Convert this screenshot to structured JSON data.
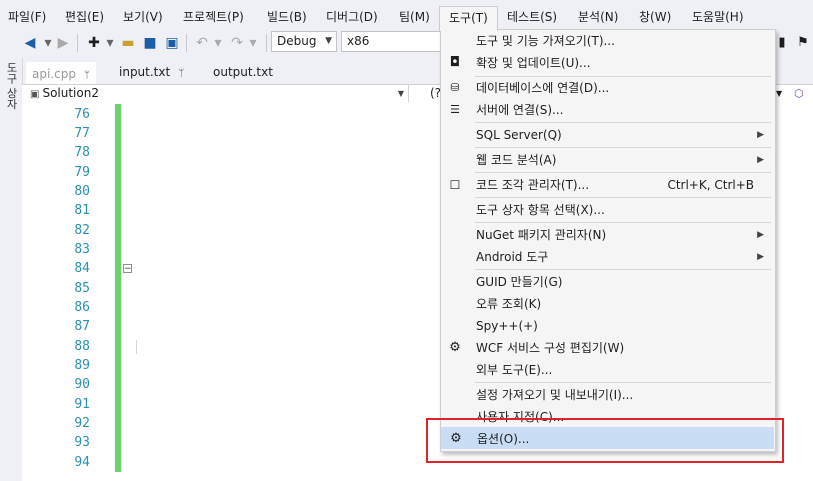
{
  "menubar": {
    "items": [
      "파일(F)",
      "편집(E)",
      "보기(V)",
      "프로젝트(P)",
      "빌드(B)",
      "디버그(D)",
      "팀(M)",
      "도구(T)",
      "테스트(S)",
      "분석(N)",
      "창(W)",
      "도움말(H)"
    ],
    "active": "도구(T)"
  },
  "toolbar": {
    "config": "Debug",
    "platform": "x86"
  },
  "toolbox": {
    "label": "도구 상자"
  },
  "tabs": [
    {
      "label": "api.cpp",
      "pin": "ᛘ",
      "active": true
    },
    {
      "label": "input.txt",
      "pin": "ᛘ"
    },
    {
      "label": "output.txt"
    }
  ],
  "navbar": {
    "solution": "Solution2",
    "scope": "(?"
  },
  "editor": {
    "line_numbers": [
      "76",
      "77",
      "78",
      "79",
      "80",
      "81",
      "82",
      "83",
      "84",
      "85",
      "86",
      "87",
      "88",
      "89",
      "90",
      "91",
      "92",
      "93",
      "94"
    ],
    "fold_glyph": "−"
  },
  "dropdown": {
    "items": [
      {
        "label": "도구 및 기능 가져오기(T)...",
        "icon": ""
      },
      {
        "label": "확장 및 업데이트(U)...",
        "icon": "extensions-icon"
      },
      {
        "label": "데이터베이스에 연결(D)...",
        "icon": "database-icon"
      },
      {
        "label": "서버에 연결(S)...",
        "icon": "server-icon"
      },
      {
        "label": "SQL Server(Q)",
        "submenu": true
      },
      {
        "label": "웹 코드 분석(A)",
        "submenu": true
      },
      {
        "label": "코드 조각 관리자(T)...",
        "icon": "snippet-icon",
        "shortcut": "Ctrl+K, Ctrl+B"
      },
      {
        "label": "도구 상자 항목 선택(X)..."
      },
      {
        "label": "NuGet 패키지 관리자(N)",
        "submenu": true
      },
      {
        "label": "Android 도구",
        "submenu": true
      },
      {
        "label": "GUID 만들기(G)"
      },
      {
        "label": "오류 조회(K)"
      },
      {
        "label": "Spy++(+)"
      },
      {
        "label": "WCF 서비스 구성 편집기(W)",
        "icon": "gears-icon"
      },
      {
        "label": "외부 도구(E)..."
      },
      {
        "label": "설정 가져오기 및 내보내기(I)..."
      },
      {
        "label": "사용자 지정(C)..."
      },
      {
        "label": "옵션(O)...",
        "icon": "gear-icon",
        "highlighted": true
      }
    ]
  },
  "colors": {
    "highlight_box": "#e0232b",
    "change_bar": "#6cd26c",
    "line_number": "#2b91af"
  }
}
